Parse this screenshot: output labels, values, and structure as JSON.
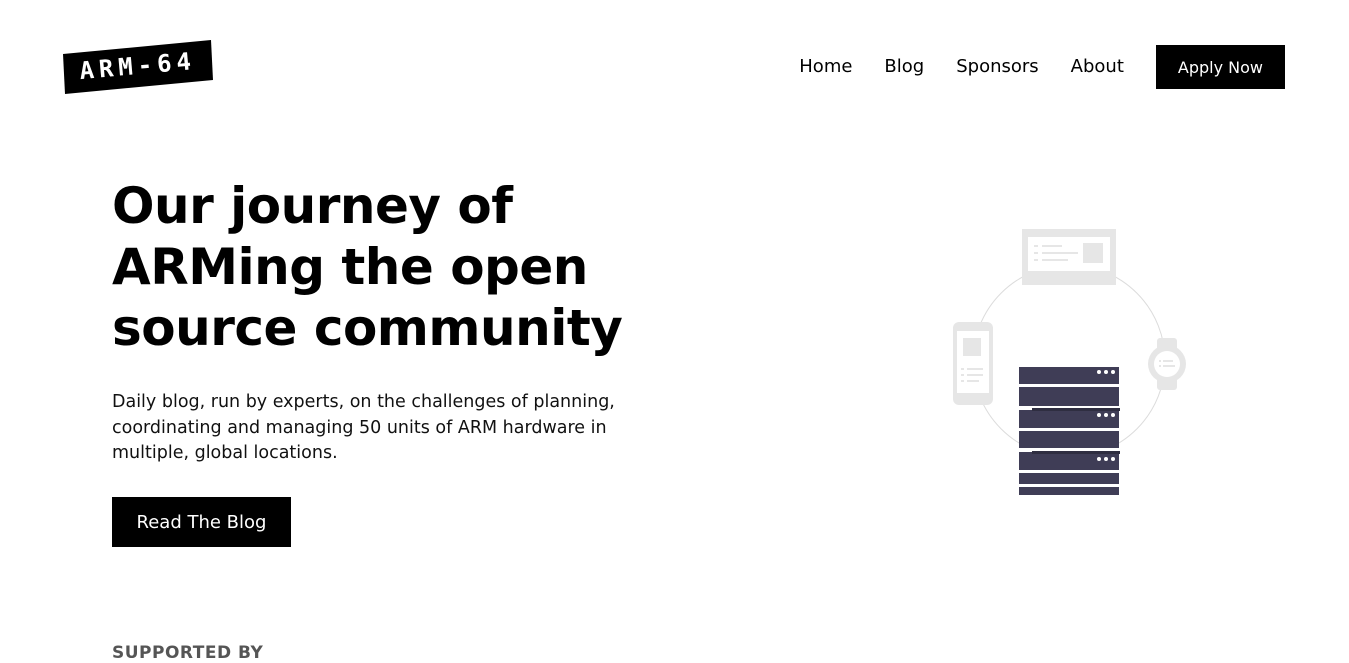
{
  "header": {
    "logo_text": "ARM-64",
    "nav": [
      "Home",
      "Blog",
      "Sponsors",
      "About"
    ],
    "apply_label": "Apply Now"
  },
  "hero": {
    "title": "Our journey of ARMing the open source community",
    "description": "Daily blog, run by experts, on the challenges of planning, coordinating and managing 50 units of ARM hardware in multiple, global locations.",
    "cta_label": "Read The Blog"
  },
  "sections": {
    "supported_by": "SUPPORTED BY"
  },
  "colors": {
    "accent": "#000000",
    "server": "#3f3d56",
    "device_gray": "#e6e6e6"
  }
}
